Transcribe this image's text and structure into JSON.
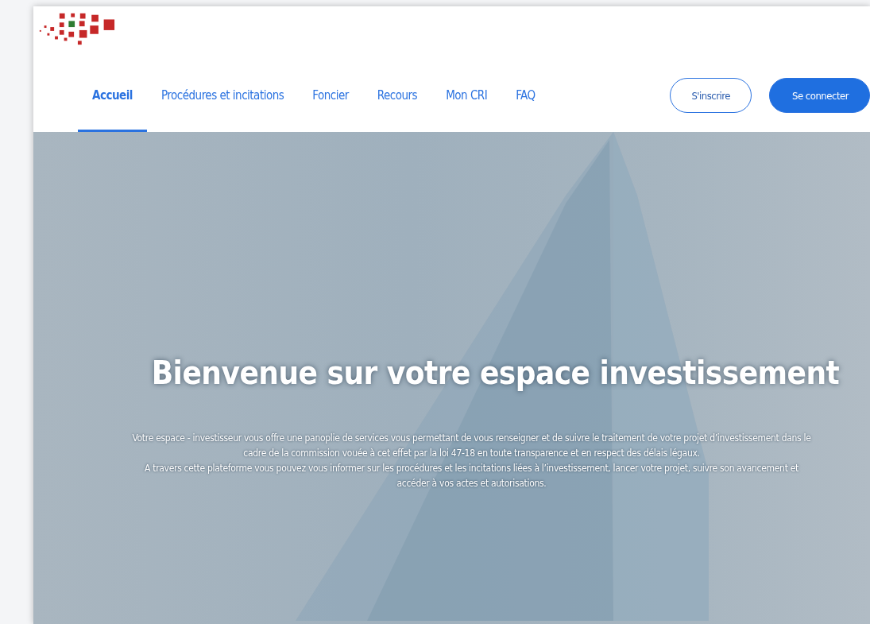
{
  "nav": {
    "tabs": [
      {
        "label": "Accueil",
        "selected": true
      },
      {
        "label": "Procédures et incitations",
        "selected": false
      },
      {
        "label": "Foncier",
        "selected": false
      },
      {
        "label": "Recours",
        "selected": false
      },
      {
        "label": "Mon CRI",
        "selected": false
      },
      {
        "label": "FAQ",
        "selected": false
      }
    ],
    "buttons": [
      {
        "label": "S'inscrire",
        "kind": "outline"
      },
      {
        "label": "Se connecter",
        "kind": "filled"
      }
    ]
  },
  "hero": {
    "title": "Bienvenue sur votre espace investissement",
    "paragraphs": [
      "Votre espace - investisseur vous offre une panoplie de services vous permettant de vous renseigner et de suivre le traitement de votre projet d’investissement dans le cadre de la commission vouée à cet effet par la loi 47-18 en toute transparence et en respect des délais légaux.",
      "A travers cette plateforme vous pouvez vous informer sur les procédures et les incitations liées à l’investissement, lancer votre projet, suivre son avancement et accéder à vos actes et autorisations."
    ]
  }
}
